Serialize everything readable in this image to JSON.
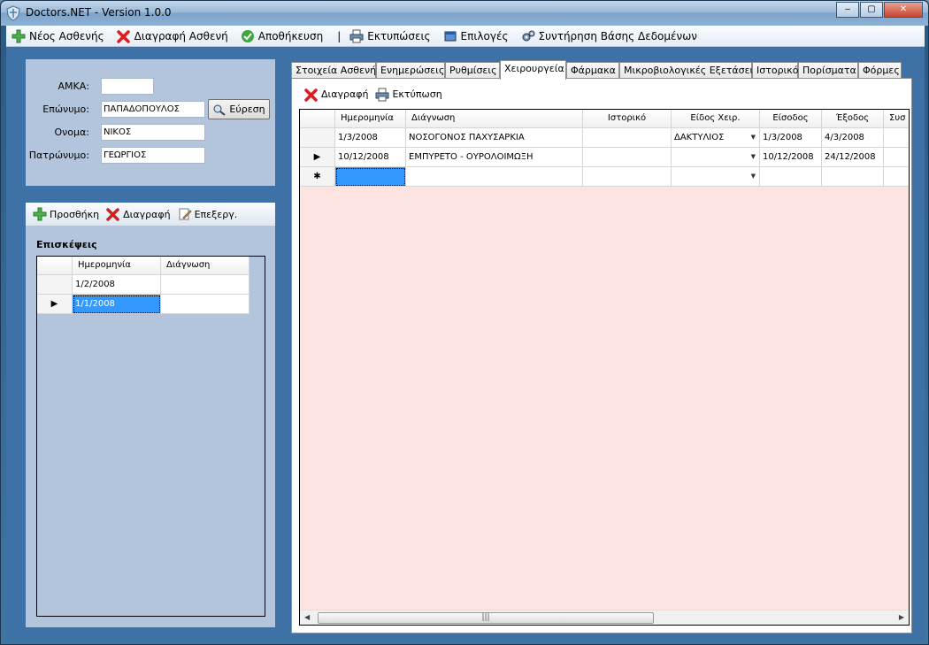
{
  "window": {
    "title": "Doctors.NET - Version 1.0.0",
    "btn_min": "‒",
    "btn_max": "▢",
    "btn_close": "✕"
  },
  "menu": {
    "new_patient": "Νέος Ασθενής",
    "delete_patient": "Διαγραφή Ασθενή",
    "save": "Αποθήκευση",
    "separator": "|",
    "printouts": "Εκτυπώσεις",
    "options": "Επιλογές",
    "db_maintenance": "Συντήρηση Βάσης Δεδομένων"
  },
  "patient": {
    "amka_label": "ΑΜΚΑ:",
    "amka_value": "",
    "surname_label": "Επώνυμο:",
    "surname_value": "ΠΑΠΑΔΟΠΟΥΛΟΣ",
    "name_label": "Ονομα:",
    "name_value": "ΝΙΚΟΣ",
    "father_label": "Πατρώνυμο:",
    "father_value": "ΓΕΩΡΓΙΟΣ",
    "find_button": "Εύρεση"
  },
  "visits": {
    "toolbar": {
      "add": "Προσθήκη",
      "delete": "Διαγραφή",
      "edit": "Επεξεργ."
    },
    "title": "Επισκέψεις",
    "columns": [
      "Ημερομηνία",
      "Διάγνωση"
    ],
    "rows": [
      {
        "date": "1/2/2008",
        "diagnosis": ""
      },
      {
        "date": "1/1/2008",
        "diagnosis": ""
      }
    ]
  },
  "tabs": [
    "Στοιχεία Ασθενή",
    "Ενημερώσεις",
    "Ρυθμίσεις",
    "Χειρουργεία",
    "Φάρμακα",
    "Μικροβιολογικές Εξετάσεις",
    "Ιστορικό",
    "Πορίσματα",
    "Φόρμες"
  ],
  "surgeries": {
    "toolbar": {
      "delete": "Διαγραφή",
      "print": "Εκτύπωση"
    },
    "columns": [
      "Ημερομηνία",
      "Διάγνωση",
      "Ιστορικό",
      "Είδος Χειρ.",
      "Είσοδος",
      "Έξοδος",
      "Συσ"
    ],
    "rows": [
      {
        "date": "1/3/2008",
        "diagnosis": "ΝΟΣΟΓΟΝΟΣ ΠΑΧΥΣΑΡΚΙΑ",
        "history": "",
        "type": "ΔΑΚΤΥΛΙΟΣ",
        "entry": "1/3/2008",
        "exit": "4/3/2008"
      },
      {
        "date": "10/12/2008",
        "diagnosis": "ΕΜΠΥΡΕΤΟ - ΟΥΡΟΛΟΙΜΩΞΗ",
        "history": "",
        "type": "",
        "entry": "10/12/2008",
        "exit": "24/12/2008"
      }
    ],
    "new_row_marker": "✱",
    "current_row_marker": "▶",
    "scroll_grip": "|||"
  },
  "colors": {
    "tab_bg": "#fde4e0",
    "panel_bg": "#b3c4dd",
    "client_bg": "#3e72a6",
    "selection": "#3399ff"
  }
}
